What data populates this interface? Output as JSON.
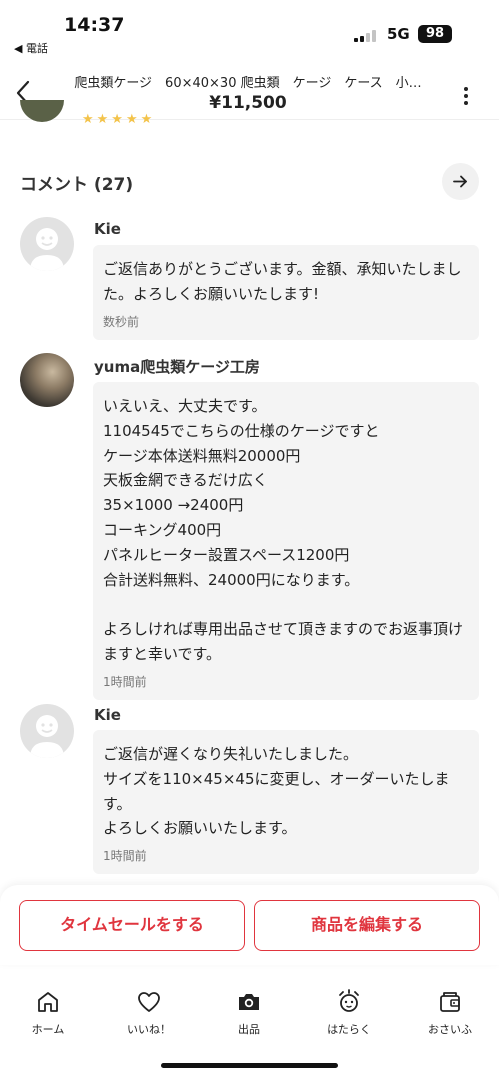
{
  "status_bar": {
    "time": "14:37",
    "back_app": "◀ 電話",
    "network": "5G",
    "battery": "98"
  },
  "header": {
    "title": "爬虫類ケージ　60×40×30 爬虫類　ケージ　ケース　小…",
    "price": "¥11,500",
    "back_icon": "chevron-left-icon",
    "more_icon": "vertical-dots-icon"
  },
  "peek": {
    "stars": "★★★★★"
  },
  "comments": {
    "title": "コメント (27)",
    "arrow_icon": "arrow-right-icon",
    "items": [
      {
        "name": "Kie",
        "text": "ご返信ありがとうございます。金額、承知いたしました。よろしくお願いいたします!",
        "time": "数秒前",
        "avatar": "default-user-avatar"
      },
      {
        "name": "yuma爬虫類ケージ工房",
        "text": "いえいえ、大丈夫です。\n1104545でこちらの仕様のケージですと\nケージ本体送料無料20000円\n天板金網できるだけ広く\n35×1000 →2400円\nコーキング400円\nパネルヒーター設置スペース1200円\n合計送料無料、24000円になります。\n\nよろしければ専用出品させて頂きますのでお返事頂けますと幸いです。",
        "time": "1時間前",
        "avatar": "shop-photo-avatar"
      },
      {
        "name": "Kie",
        "text": "ご返信が遅くなり失礼いたしました。\nサイズを110×45×45に変更し、オーダーいたします。\nよろしくお願いいたします。",
        "time": "1時間前",
        "avatar": "default-user-avatar"
      }
    ]
  },
  "actions": {
    "time_sale": "タイムセールをする",
    "edit_item": "商品を編集する"
  },
  "tabs": [
    {
      "label": "ホーム",
      "icon": "home-icon"
    },
    {
      "label": "いいね！",
      "icon": "heart-icon"
    },
    {
      "label": "出品",
      "icon": "camera-icon"
    },
    {
      "label": "はたらく",
      "icon": "alarm-clock-icon"
    },
    {
      "label": "おさいふ",
      "icon": "wallet-icon"
    }
  ],
  "colors": {
    "accent": "#e0353e",
    "bubble": "#f4f4f4",
    "star": "#f3c34a"
  }
}
